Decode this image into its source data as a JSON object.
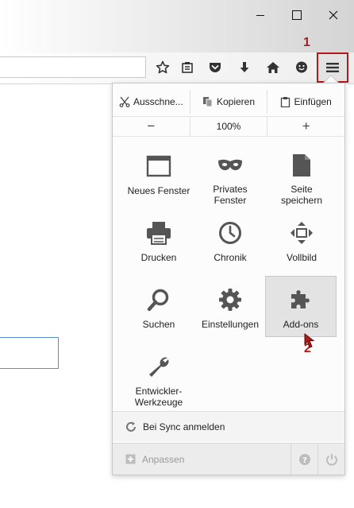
{
  "steps": {
    "first": "1",
    "second": "2"
  },
  "menu": {
    "edit": {
      "cut": "Ausschne...",
      "copy": "Kopieren",
      "paste": "Einfügen"
    },
    "zoom": {
      "minus": "−",
      "level": "100%",
      "plus": "+"
    },
    "items": [
      {
        "label": "Neues Fenster",
        "icon": "new-window-icon"
      },
      {
        "label": "Privates Fenster",
        "icon": "private-mask-icon"
      },
      {
        "label": "Seite speichern",
        "icon": "save-page-icon"
      },
      {
        "label": "Drucken",
        "icon": "print-icon"
      },
      {
        "label": "Chronik",
        "icon": "history-clock-icon"
      },
      {
        "label": "Vollbild",
        "icon": "fullscreen-icon"
      },
      {
        "label": "Suchen",
        "icon": "search-icon"
      },
      {
        "label": "Einstellungen",
        "icon": "gear-icon"
      },
      {
        "label": "Add-ons",
        "icon": "puzzle-icon"
      },
      {
        "label": "Entwickler-Werkzeuge",
        "icon": "wrench-icon"
      }
    ],
    "sync": "Bei Sync anmelden",
    "customize": "Anpassen"
  },
  "colors": {
    "accent_red": "#b11a1a",
    "icon_gray": "#555555",
    "highlight": "#e3e3e3"
  }
}
